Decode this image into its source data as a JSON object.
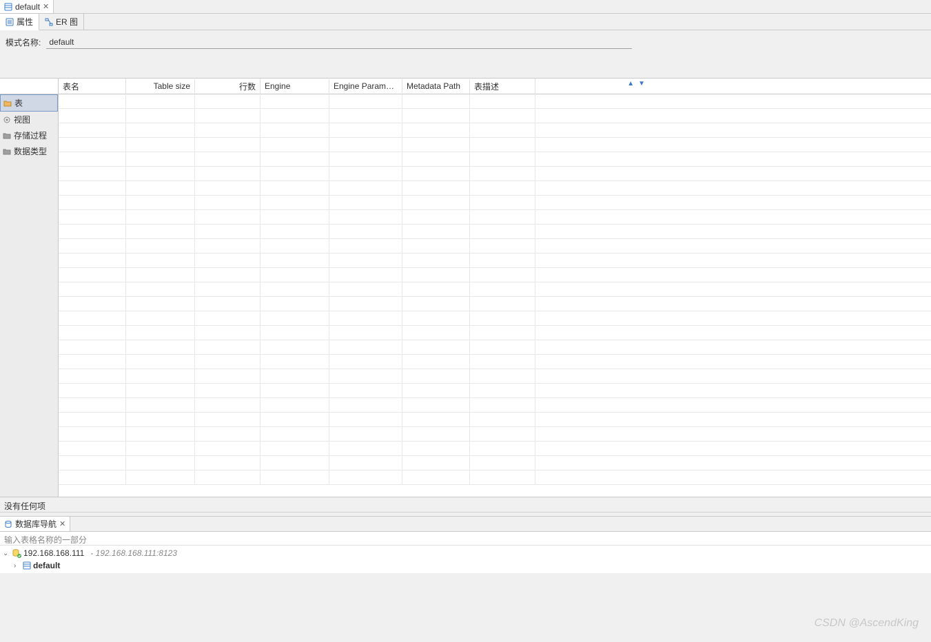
{
  "editor": {
    "tab_label": "default"
  },
  "subtabs": {
    "properties": "属性",
    "er_diagram": "ER 图"
  },
  "schema": {
    "label": "模式名称:",
    "value": "default"
  },
  "sidebar": {
    "items": [
      {
        "label": "表"
      },
      {
        "label": "视图"
      },
      {
        "label": "存储过程"
      },
      {
        "label": "数据类型"
      }
    ]
  },
  "table": {
    "columns": {
      "name": "表名",
      "size": "Table size",
      "rows": "行数",
      "engine": "Engine",
      "params": "Engine Paramet...",
      "meta": "Metadata Path",
      "desc": "表描述"
    }
  },
  "status": {
    "empty": "没有任何项"
  },
  "bottom": {
    "tab_label": "数据库导航",
    "filter_placeholder": "输入表格名称的一部分",
    "tree": {
      "connection": "192.168.168.111",
      "connection_sub": "- 192.168.168.111:8123",
      "schema": "default"
    }
  },
  "watermark": "CSDN @AscendKing"
}
